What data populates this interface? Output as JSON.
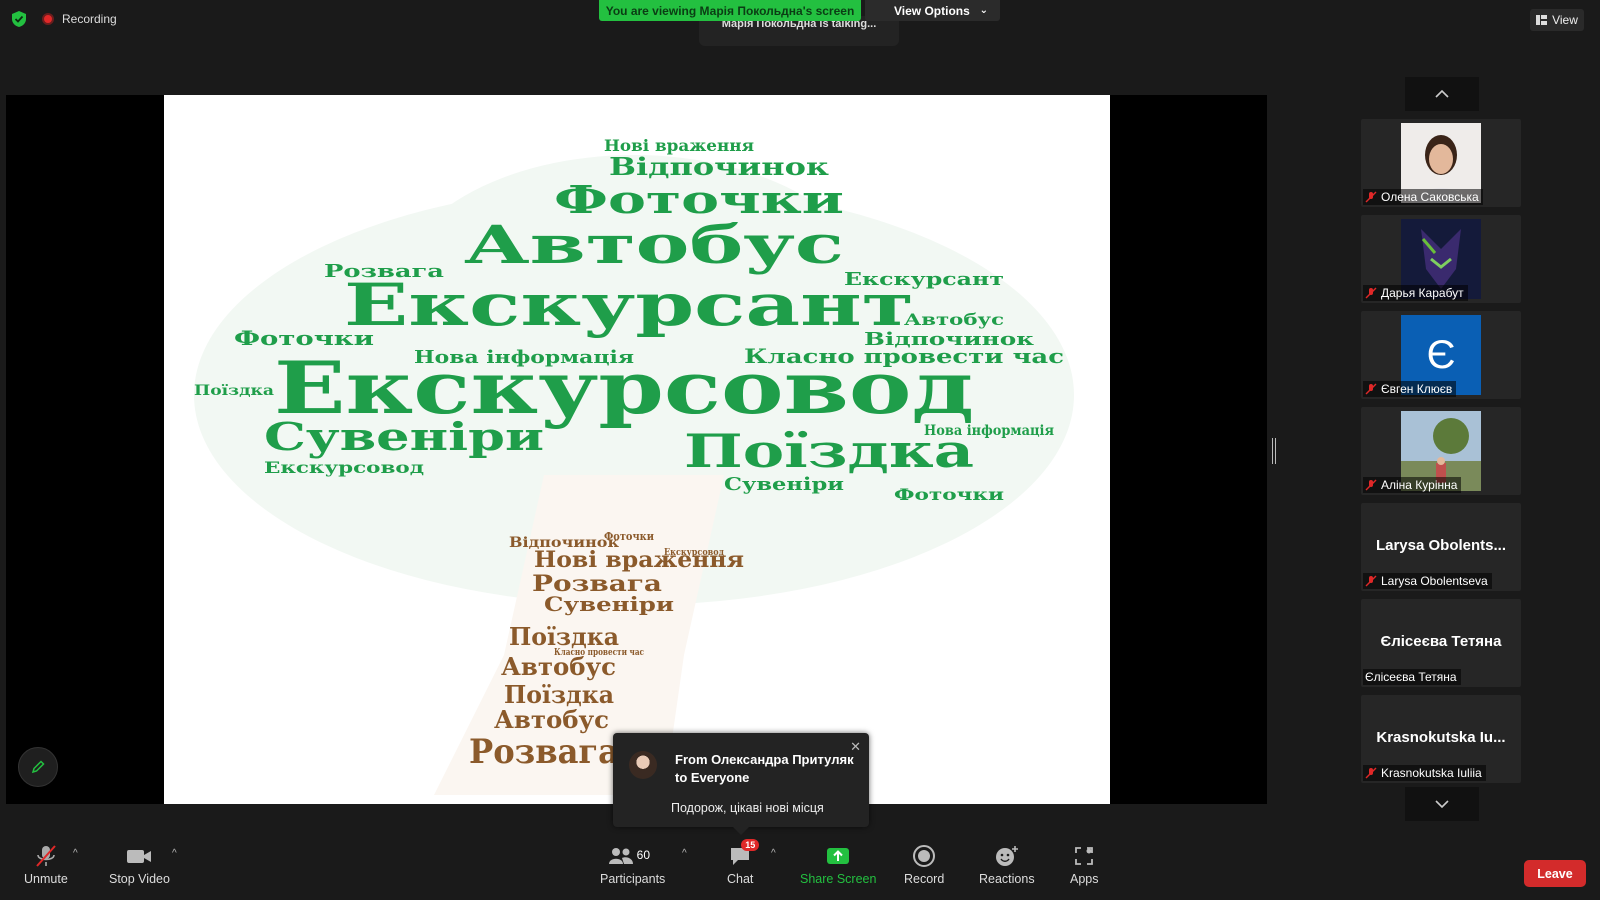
{
  "top_bar": {
    "recording_label": "Recording",
    "share_banner": "You are viewing Марія Покольдна's screen",
    "view_options_label": "View Options",
    "talking_indicator": "Марія Покольдна is talking...",
    "view_label": "View"
  },
  "slide": {
    "words_green": [
      "Екскурсовод",
      "Екскурсант",
      "Автобус",
      "Фоточки",
      "Відпочинок",
      "Нові враження",
      "Нова інформація",
      "Класно провести час",
      "Поїздка",
      "Сувеніри",
      "Розвага"
    ],
    "words_brown": [
      "Нові враження",
      "Розвага",
      "Сувеніри",
      "Поїздка",
      "Автобус",
      "Автобус",
      "Поїздка",
      "Розвага",
      "Відпочинок",
      "Класно провести час",
      "Фоточки",
      "Екскурсовод"
    ]
  },
  "gallery": {
    "participants": [
      {
        "name": "Олена Саковська",
        "type": "photo",
        "muted": true
      },
      {
        "name": "Дарья Карабут",
        "type": "photo",
        "muted": true
      },
      {
        "name": "Євген Клюєв",
        "type": "letter",
        "letter": "Є",
        "muted": true
      },
      {
        "name": "Аліна Курінна",
        "type": "photo",
        "muted": true
      },
      {
        "name": "Larysa Obolentseva",
        "type": "name",
        "display": "Larysa  Obolents...",
        "muted": true
      },
      {
        "name": "Єлісеєва Тетяна",
        "type": "name",
        "display": "Єлісеєва Тетяна",
        "muted": false
      },
      {
        "name": "Krasnokutska Iuliia",
        "type": "name",
        "display": "Krasnokutska  Iu...",
        "muted": true
      }
    ]
  },
  "chat_popup": {
    "from": "From Олександра Притуляк to Everyone",
    "message": "Подорож, цікаві нові місця"
  },
  "toolbar": {
    "unmute": "Unmute",
    "stop_video": "Stop Video",
    "participants": "Participants",
    "participants_count": "60",
    "chat": "Chat",
    "chat_badge": "15",
    "share_screen": "Share Screen",
    "record": "Record",
    "reactions": "Reactions",
    "apps": "Apps",
    "leave": "Leave"
  },
  "colors": {
    "green_accent": "#23c040",
    "leave_red": "#d32b2b",
    "word_green": "#1f9e4a",
    "word_brown": "#8b5a2b"
  }
}
